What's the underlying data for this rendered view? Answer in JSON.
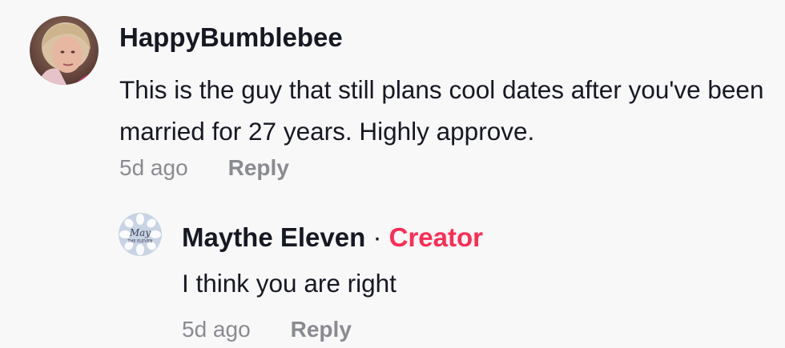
{
  "comments": [
    {
      "username": "HappyBumblebee",
      "text": "This is the guy that still plans cool dates after you've been married for 27 years. Highly approve.",
      "time": "5d ago",
      "reply_label": "Reply"
    }
  ],
  "reply": {
    "username": "Maythe Eleven",
    "separator": "·",
    "badge": "Creator",
    "text": "I think you are right",
    "time": "5d ago",
    "reply_label": "Reply",
    "avatar_logo": "MAY THE ELEVEN"
  },
  "colors": {
    "background": "#f8f8f8",
    "text": "#161823",
    "muted": "#8a8b91",
    "creator_badge": "#fe2c55"
  }
}
